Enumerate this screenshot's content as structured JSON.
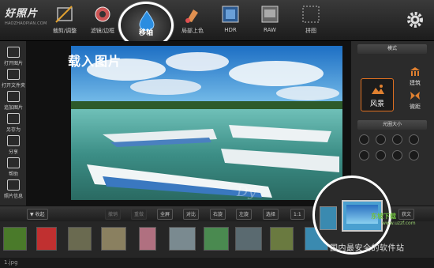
{
  "app": {
    "logo_title": "好照片",
    "logo_sub": "HAOZHAOPIAN.COM"
  },
  "top_tools": [
    {
      "label": "裁剪/调整",
      "icon": "crop-adjust-icon"
    },
    {
      "label": "滤镜/边框",
      "icon": "filter-frame-icon"
    },
    {
      "label": "移轴",
      "icon": "tilt-shift-icon"
    },
    {
      "label": "局部上色",
      "icon": "partial-color-icon"
    },
    {
      "label": "HDR",
      "icon": "hdr-icon"
    },
    {
      "label": "RAW",
      "icon": "raw-icon"
    },
    {
      "label": "拼图",
      "icon": "collage-icon"
    }
  ],
  "left_tools": [
    {
      "label": "打开图片",
      "icon": "open-image-icon"
    },
    {
      "label": "打开文件夹",
      "icon": "open-folder-icon"
    },
    {
      "label": "追加图片",
      "icon": "add-image-icon"
    },
    {
      "label": "另存为",
      "icon": "save-as-icon"
    },
    {
      "label": "分享",
      "icon": "share-icon"
    },
    {
      "label": "帮助",
      "icon": "help-icon"
    },
    {
      "label": "照片信息",
      "icon": "photo-info-icon"
    }
  ],
  "overlay_title": "载入图片",
  "photo_watermark": "Dy",
  "right_panel": {
    "mode_header": "模式",
    "modes": [
      {
        "label": "风景",
        "active": true
      },
      {
        "label": "建筑",
        "active": false
      },
      {
        "label": "微距",
        "active": false
      }
    ],
    "aperture_header": "光圈大小"
  },
  "toolbar": {
    "collapse": "收起",
    "rotate_left": "撤销",
    "rotate_right": "重做",
    "fullscreen": "全屏",
    "compare": "对比",
    "right_rotate": "右旋",
    "left_rotate": "左旋",
    "select": "选择",
    "ratio": "1:1",
    "unfold": "获文"
  },
  "status_text": "1.jpg",
  "watermarks": {
    "center": "国内最安全的软件站",
    "brand": "东坡下载",
    "url": "www.uzzf.com"
  },
  "colors": {
    "accent": "#e07020",
    "bg": "#202020"
  }
}
